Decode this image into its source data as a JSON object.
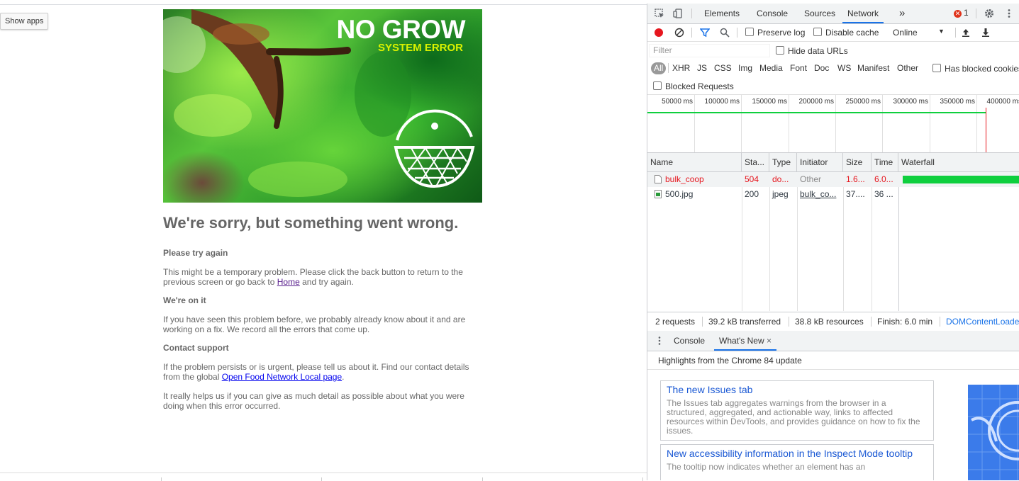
{
  "browser": {
    "tooltip": "Show apps"
  },
  "page": {
    "hero": {
      "title": "NO GROW",
      "subtitle": "SYSTEM ERROR"
    },
    "heading": "We're sorry, but something went wrong.",
    "sections": [
      {
        "title": "Please try again",
        "text_before": "This might be a temporary problem. Please click the back button to return to the previous screen or go back to ",
        "link": "Home",
        "text_after": " and try again."
      },
      {
        "title": "We're on it",
        "text": "If you have seen this problem before, we probably already know about it and are working on a fix. We record all the errors that come up."
      },
      {
        "title": "Contact support",
        "text_before": "If the problem persists or is urgent, please tell us about it. Find our contact details from the global ",
        "link": "Open Food Network Local page",
        "text_after": "."
      }
    ],
    "closing": "It really helps us if you can give as much detail as possible about what you were doing when this error occurred."
  },
  "devtools": {
    "tabs": [
      "Elements",
      "Console",
      "Sources",
      "Network"
    ],
    "active_tab": "Network",
    "more_tabs": "»",
    "error_count": "1",
    "toolbar": {
      "preserve_log": "Preserve log",
      "disable_cache": "Disable cache",
      "throttle": "Online"
    },
    "filter": {
      "placeholder": "Filter",
      "hide_data_urls": "Hide data URLs",
      "types": [
        "All",
        "XHR",
        "JS",
        "CSS",
        "Img",
        "Media",
        "Font",
        "Doc",
        "WS",
        "Manifest",
        "Other"
      ],
      "has_blocked_cookies": "Has blocked cookies",
      "blocked_requests": "Blocked Requests"
    },
    "overview_ticks": [
      "50000 ms",
      "100000 ms",
      "150000 ms",
      "200000 ms",
      "250000 ms",
      "300000 ms",
      "350000 ms",
      "400000 ms"
    ],
    "columns": [
      "Name",
      "Sta...",
      "Type",
      "Initiator",
      "Size",
      "Time",
      "Waterfall"
    ],
    "requests": [
      {
        "name": "bulk_coop",
        "status": "504",
        "type": "do...",
        "initiator": "Other",
        "size": "1.6...",
        "time": "6.0..."
      },
      {
        "name": "500.jpg",
        "status": "200",
        "type": "jpeg",
        "initiator": "bulk_co...",
        "size": "37....",
        "time": "36 ..."
      }
    ],
    "summary": {
      "requests": "2 requests",
      "transferred": "39.2 kB transferred",
      "resources": "38.8 kB resources",
      "finish": "Finish: 6.0 min",
      "dom": "DOMContentLoade"
    },
    "drawer": {
      "tabs": [
        "Console",
        "What's New"
      ],
      "close": "×",
      "highlights": "Highlights from the Chrome 84 update",
      "cards": [
        {
          "title": "The new Issues tab",
          "body": "The Issues tab aggregates warnings from the browser in a structured, aggregated, and actionable way, links to affected resources within DevTools, and provides guidance on how to fix the issues."
        },
        {
          "title": "New accessibility information in the Inspect Mode tooltip",
          "body": "The tooltip now indicates whether an element has an"
        }
      ]
    }
  }
}
